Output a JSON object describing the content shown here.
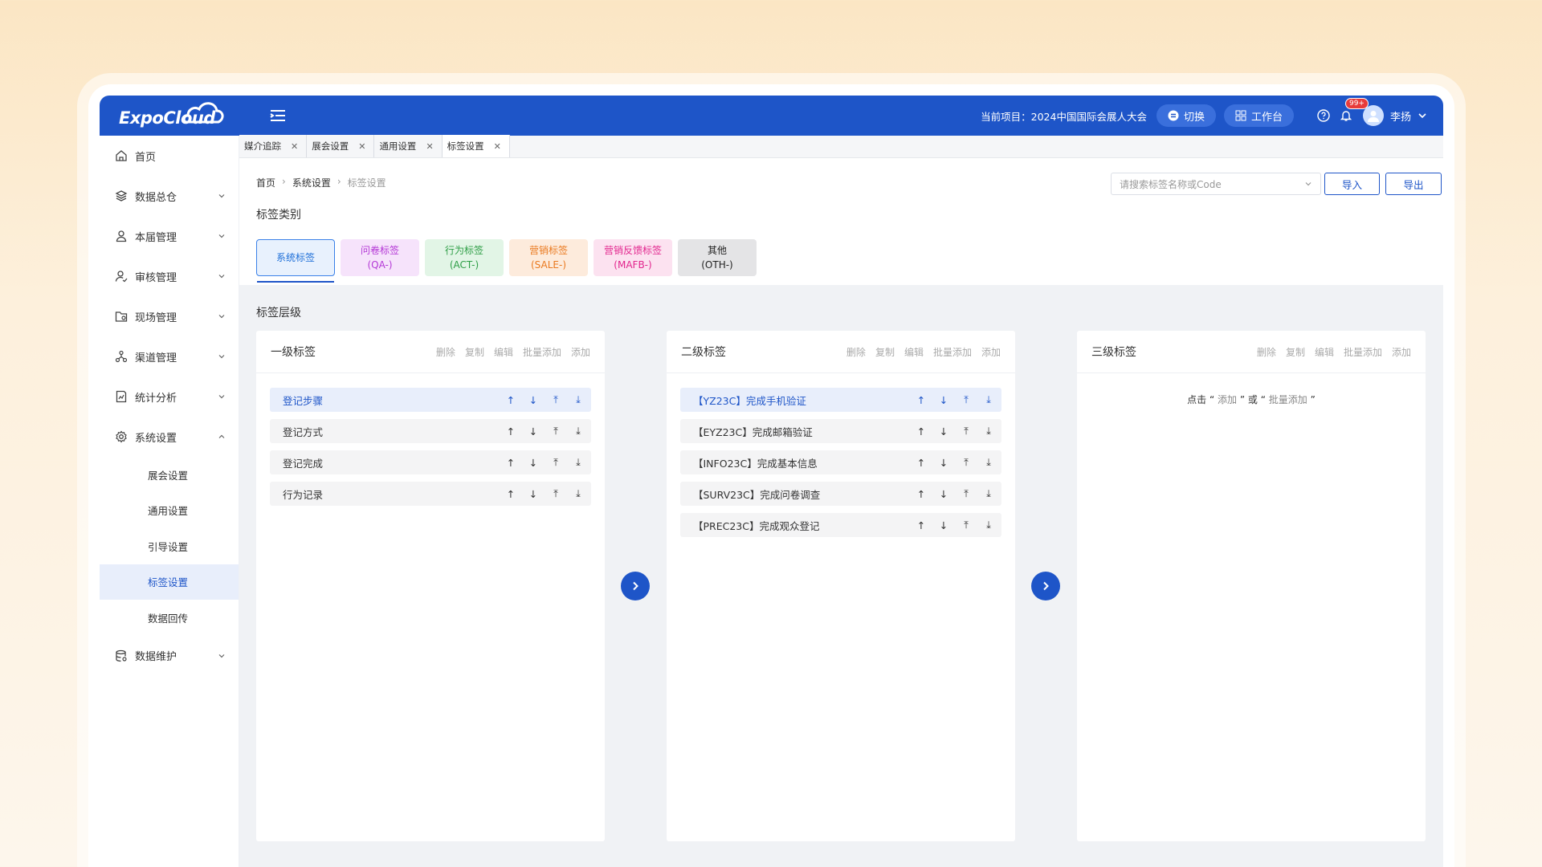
{
  "app": {
    "logo": "ExpoCloud",
    "brand_color": "#1e55c8"
  },
  "header": {
    "project_label": "当前项目：2024中国国际会展人大会",
    "switch_label": "切换",
    "workbench_label": "工作台",
    "badge": "99+",
    "username": "李扬"
  },
  "sidebar": {
    "items": [
      {
        "label": "首页",
        "icon": "home-icon"
      },
      {
        "label": "数据总仓",
        "icon": "layers-icon"
      },
      {
        "label": "本届管理",
        "icon": "user-icon"
      },
      {
        "label": "审核管理",
        "icon": "user-check-icon"
      },
      {
        "label": "现场管理",
        "icon": "folder-icon"
      },
      {
        "label": "渠道管理",
        "icon": "network-icon"
      },
      {
        "label": "统计分析",
        "icon": "chart-icon"
      },
      {
        "label": "系统设置",
        "icon": "gear-icon"
      }
    ],
    "sub_items": [
      "展会设置",
      "通用设置",
      "引导设置",
      "标签设置",
      "数据回传"
    ],
    "last_item": {
      "label": "数据维护",
      "icon": "database-icon"
    }
  },
  "tabs": [
    {
      "label": "媒介追踪"
    },
    {
      "label": "展会设置"
    },
    {
      "label": "通用设置"
    },
    {
      "label": "标签设置"
    }
  ],
  "breadcrumb": [
    "首页",
    "系统设置",
    "标签设置"
  ],
  "search": {
    "placeholder": "请搜索标签名称或Code"
  },
  "buttons": {
    "import": "导入",
    "export": "导出"
  },
  "category_title": "标签类别",
  "categories": [
    {
      "line1": "系统标签",
      "line2": "",
      "color": "#1e6fd8",
      "bg": "#e8f1fd"
    },
    {
      "line1": "问卷标签",
      "line2": "(QA-)",
      "color": "#b438d6",
      "bg": "#f6e3fb"
    },
    {
      "line1": "行为标签",
      "line2": "(ACT-)",
      "color": "#2e9e46",
      "bg": "#e2f5e6"
    },
    {
      "line1": "营销标签",
      "line2": "(SALE-)",
      "color": "#ea7a20",
      "bg": "#fdebdc"
    },
    {
      "line1": "营销反馈标签",
      "line2": "(MAFB-)",
      "color": "#e2268e",
      "bg": "#fce2f0"
    },
    {
      "line1": "其他",
      "line2": "(OTH-)",
      "color": "#222222",
      "bg": "#e4e4e6"
    }
  ],
  "levels_title": "标签层级",
  "panel_actions": [
    "删除",
    "复制",
    "编辑",
    "批量添加",
    "添加"
  ],
  "panels": [
    {
      "title": "一级标签",
      "rows": [
        "登记步骤",
        "登记方式",
        "登记完成",
        "行为记录"
      ]
    },
    {
      "title": "二级标签",
      "rows": [
        "【YZ23C】完成手机验证",
        "【EYZ23C】完成邮箱验证",
        "【INFO23C】完成基本信息",
        "【SURV23C】完成问卷调查",
        "【PREC23C】完成观众登记"
      ]
    },
    {
      "title": "三级标签",
      "hint": {
        "pre": "点击",
        "q1": "“",
        "a": "添加",
        "q2": "”",
        "mid": "或",
        "q3": "“",
        "b": "批量添加",
        "q4": "”"
      }
    }
  ]
}
